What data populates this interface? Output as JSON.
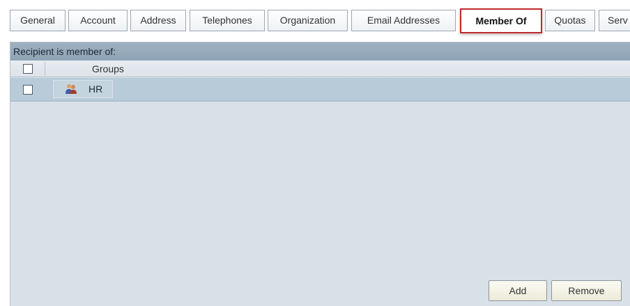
{
  "tabs": [
    {
      "label": "General"
    },
    {
      "label": "Account"
    },
    {
      "label": "Address"
    },
    {
      "label": "Telephones"
    },
    {
      "label": "Organization"
    },
    {
      "label": "Email Addresses"
    },
    {
      "label": "Member Of",
      "active": true
    },
    {
      "label": "Quotas"
    },
    {
      "label": "Serv"
    }
  ],
  "panel": {
    "header": "Recipient is member of:",
    "columns": {
      "groups": "Groups"
    },
    "rows": [
      {
        "name": "HR",
        "icon": "group-icon"
      }
    ]
  },
  "buttons": {
    "add": "Add",
    "remove": "Remove"
  },
  "colors": {
    "active_tab_border": "#c0282c",
    "panel_header": "#9eb1c1",
    "panel_background": "#d9e1e8",
    "selected_row": "#b7cbd8"
  }
}
